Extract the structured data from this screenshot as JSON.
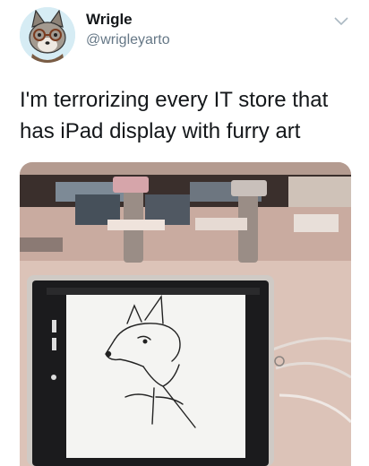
{
  "tweet": {
    "display_name": "Wrigle",
    "handle": "@wrigleyarto",
    "text": "I'm terrorizing every IT store that has iPad display with furry art"
  },
  "icons": {
    "avatar": "fox-avatar-icon",
    "menu": "chevron-down-icon"
  },
  "colors": {
    "name": "#14171a",
    "handle": "#657786",
    "background": "#ffffff"
  }
}
